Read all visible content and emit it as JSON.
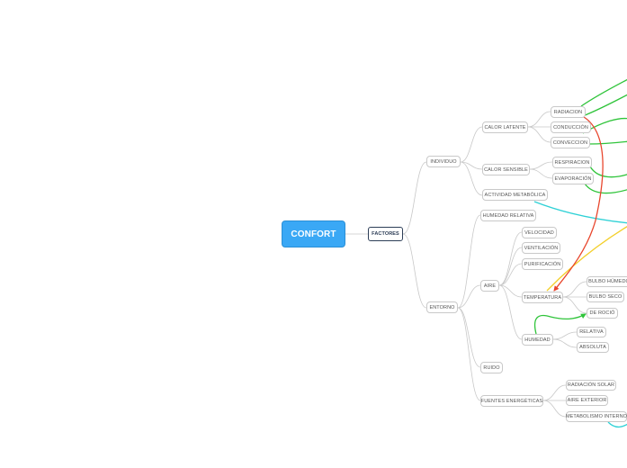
{
  "nodes": {
    "root": "CONFORT",
    "factores": "FACTORES",
    "individuo": "INDIVIDUO",
    "entorno": "ENTORNO",
    "calor_latente": "CALOR LATENTE",
    "calor_sensible": "CALOR SENSIBLE",
    "actividad_metabolica": "ACTIVIDAD METABÓLICA",
    "radiacion": "RADIACION",
    "conduccion": "CONDUCCIÓN",
    "conveccion": "CONVECCION",
    "respiracion": "RESPIRACION",
    "evaporacion": "EVAPORACIÓN",
    "humedad_relativa": "HUMEDAD RELATIVA",
    "aire": "AIRE",
    "ruido": "RUIDO",
    "fuentes_energeticas": "FUENTES ENERGÉTICAS",
    "velocidad": "VELOCIDAD",
    "ventilacion": "VENTILACIÓN",
    "purificacion": "PURIFICACIÓN",
    "temperatura": "TEMPERATURA",
    "humedad": "HUMEDAD",
    "bulbo_humedo": "BULBO HÚMEDO",
    "bulbo_seco": "BULBO SECO",
    "de_rocio": "DE ROCIÓ",
    "relativa": "RELATIVA",
    "absoluta": "ABSOLUTA",
    "radiacion_solar": "RADIACIÓN SOLAR",
    "aire_exterior": "AIRE EXTERIOR",
    "metabolismo_interno": "METABOLISMO INTERNO"
  },
  "colors": {
    "root_fill": "#3aa8f5",
    "connector": "#c8c8c8",
    "green": "#2fc43a",
    "red": "#e8452c",
    "cyan": "#2fd1d6",
    "yellow": "#f3cf2a"
  }
}
